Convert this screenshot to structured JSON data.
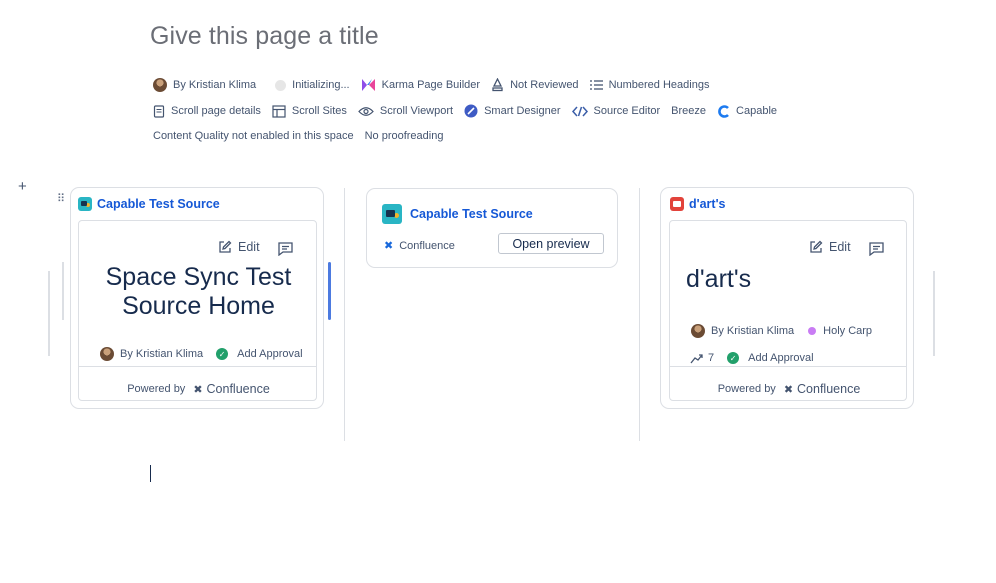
{
  "page": {
    "title_placeholder": "Give this page a title"
  },
  "byline": {
    "row1": [
      {
        "icon": "avatar",
        "label": "By Kristian Klima"
      },
      {
        "icon": "grey-dot",
        "label": "Initializing..."
      },
      {
        "icon": "karma-icon",
        "label": "Karma Page Builder"
      },
      {
        "icon": "review-icon",
        "label": "Not Reviewed"
      },
      {
        "icon": "numbered-list-icon",
        "label": "Numbered Headings"
      }
    ],
    "row2": [
      {
        "icon": "page-details-icon",
        "label": "Scroll page details"
      },
      {
        "icon": "sites-icon",
        "label": "Scroll Sites"
      },
      {
        "icon": "eye-icon",
        "label": "Scroll Viewport"
      },
      {
        "icon": "designer-icon",
        "label": "Smart Designer"
      },
      {
        "icon": "code-icon",
        "label": "Source Editor"
      },
      {
        "icon": "",
        "label": "Breeze"
      },
      {
        "icon": "capable-icon",
        "label": "Capable"
      }
    ],
    "row3": [
      {
        "label": "Content Quality not enabled in this space"
      },
      {
        "label": "No proofreading"
      }
    ]
  },
  "cards": {
    "left": {
      "title": "Capable Test Source",
      "edit_label": "Edit",
      "heading": "Space Sync Test Source Home",
      "author": "By Kristian Klima",
      "approval": "Add Approval",
      "powered_by": "Powered by",
      "brand": "Confluence"
    },
    "middle": {
      "title": "Capable Test Source",
      "source": "Confluence",
      "open_preview": "Open preview"
    },
    "right": {
      "title": "d'art's",
      "edit_label": "Edit",
      "heading": "d'art's",
      "author": "By Kristian Klima",
      "tag": "Holy Carp",
      "count": "7",
      "approval": "Add Approval",
      "powered_by": "Powered by",
      "brand": "Confluence"
    }
  },
  "colors": {
    "link": "#1558d6",
    "approval_green": "#22a06b",
    "tag_purple": "#c97cf4",
    "accent_blue": "#4c7ae0"
  }
}
